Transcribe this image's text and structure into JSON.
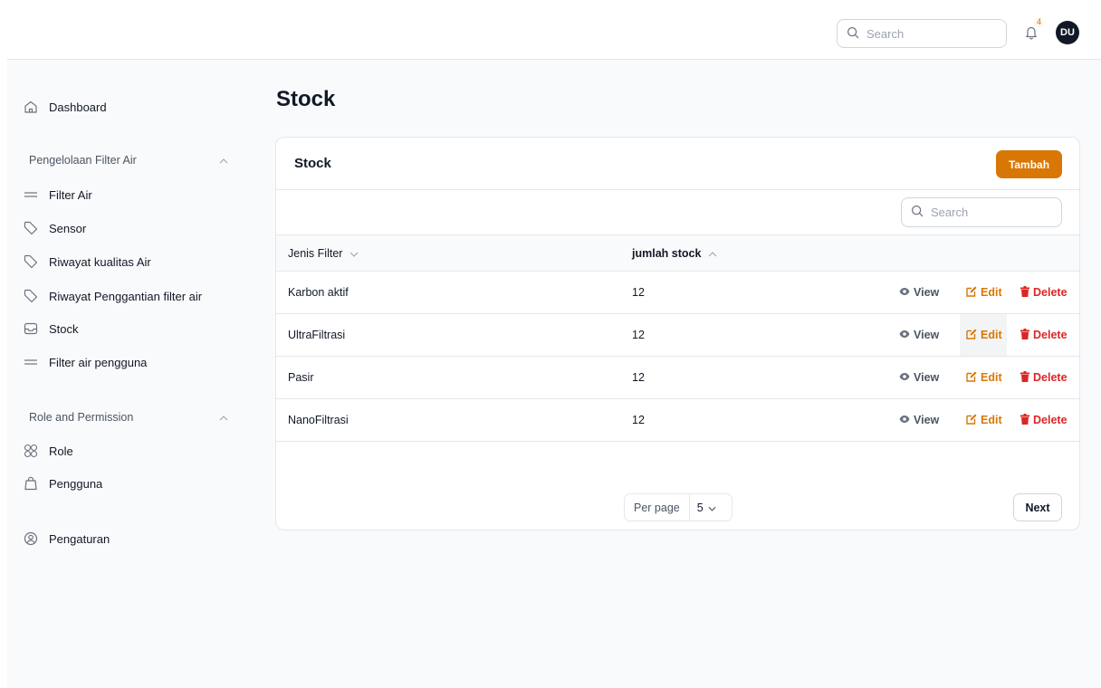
{
  "topbar": {
    "search_placeholder": "Search",
    "notification_count": "4",
    "avatar_initials": "DU"
  },
  "sidebar": {
    "dashboard": "Dashboard",
    "group1_title": "Pengelolaan Filter Air",
    "group1_items": [
      {
        "label": "Filter Air",
        "icon": "bars-icon"
      },
      {
        "label": "Sensor",
        "icon": "tag-icon"
      },
      {
        "label": "Riwayat kualitas Air",
        "icon": "tag-icon"
      },
      {
        "label": "Riwayat Penggantian filter air",
        "icon": "tag-icon"
      },
      {
        "label": "Stock",
        "icon": "inbox-icon"
      },
      {
        "label": "Filter air pengguna",
        "icon": "bars-icon"
      }
    ],
    "group2_title": "Role and Permission",
    "group2_items": [
      {
        "label": "Role",
        "icon": "grid-icon"
      },
      {
        "label": "Pengguna",
        "icon": "bag-icon"
      }
    ],
    "settings": "Pengaturan"
  },
  "main": {
    "page_title": "Stock",
    "card_title": "Stock",
    "add_button": "Tambah",
    "search_placeholder": "Search",
    "columns": [
      "Jenis Filter",
      "jumlah stock"
    ],
    "rows": [
      {
        "jenis": "Karbon aktif",
        "jumlah": "12"
      },
      {
        "jenis": "UltraFiltrasi",
        "jumlah": "12"
      },
      {
        "jenis": "Pasir",
        "jumlah": "12"
      },
      {
        "jenis": "NanoFiltrasi",
        "jumlah": "12"
      }
    ],
    "actions": {
      "view": "View",
      "edit": "Edit",
      "delete": "Delete"
    },
    "per_page_label": "Per page",
    "per_page_value": "5",
    "next_button": "Next"
  },
  "colors": {
    "accent": "#d97706",
    "danger": "#dc2626",
    "avatar_bg": "#111827"
  }
}
